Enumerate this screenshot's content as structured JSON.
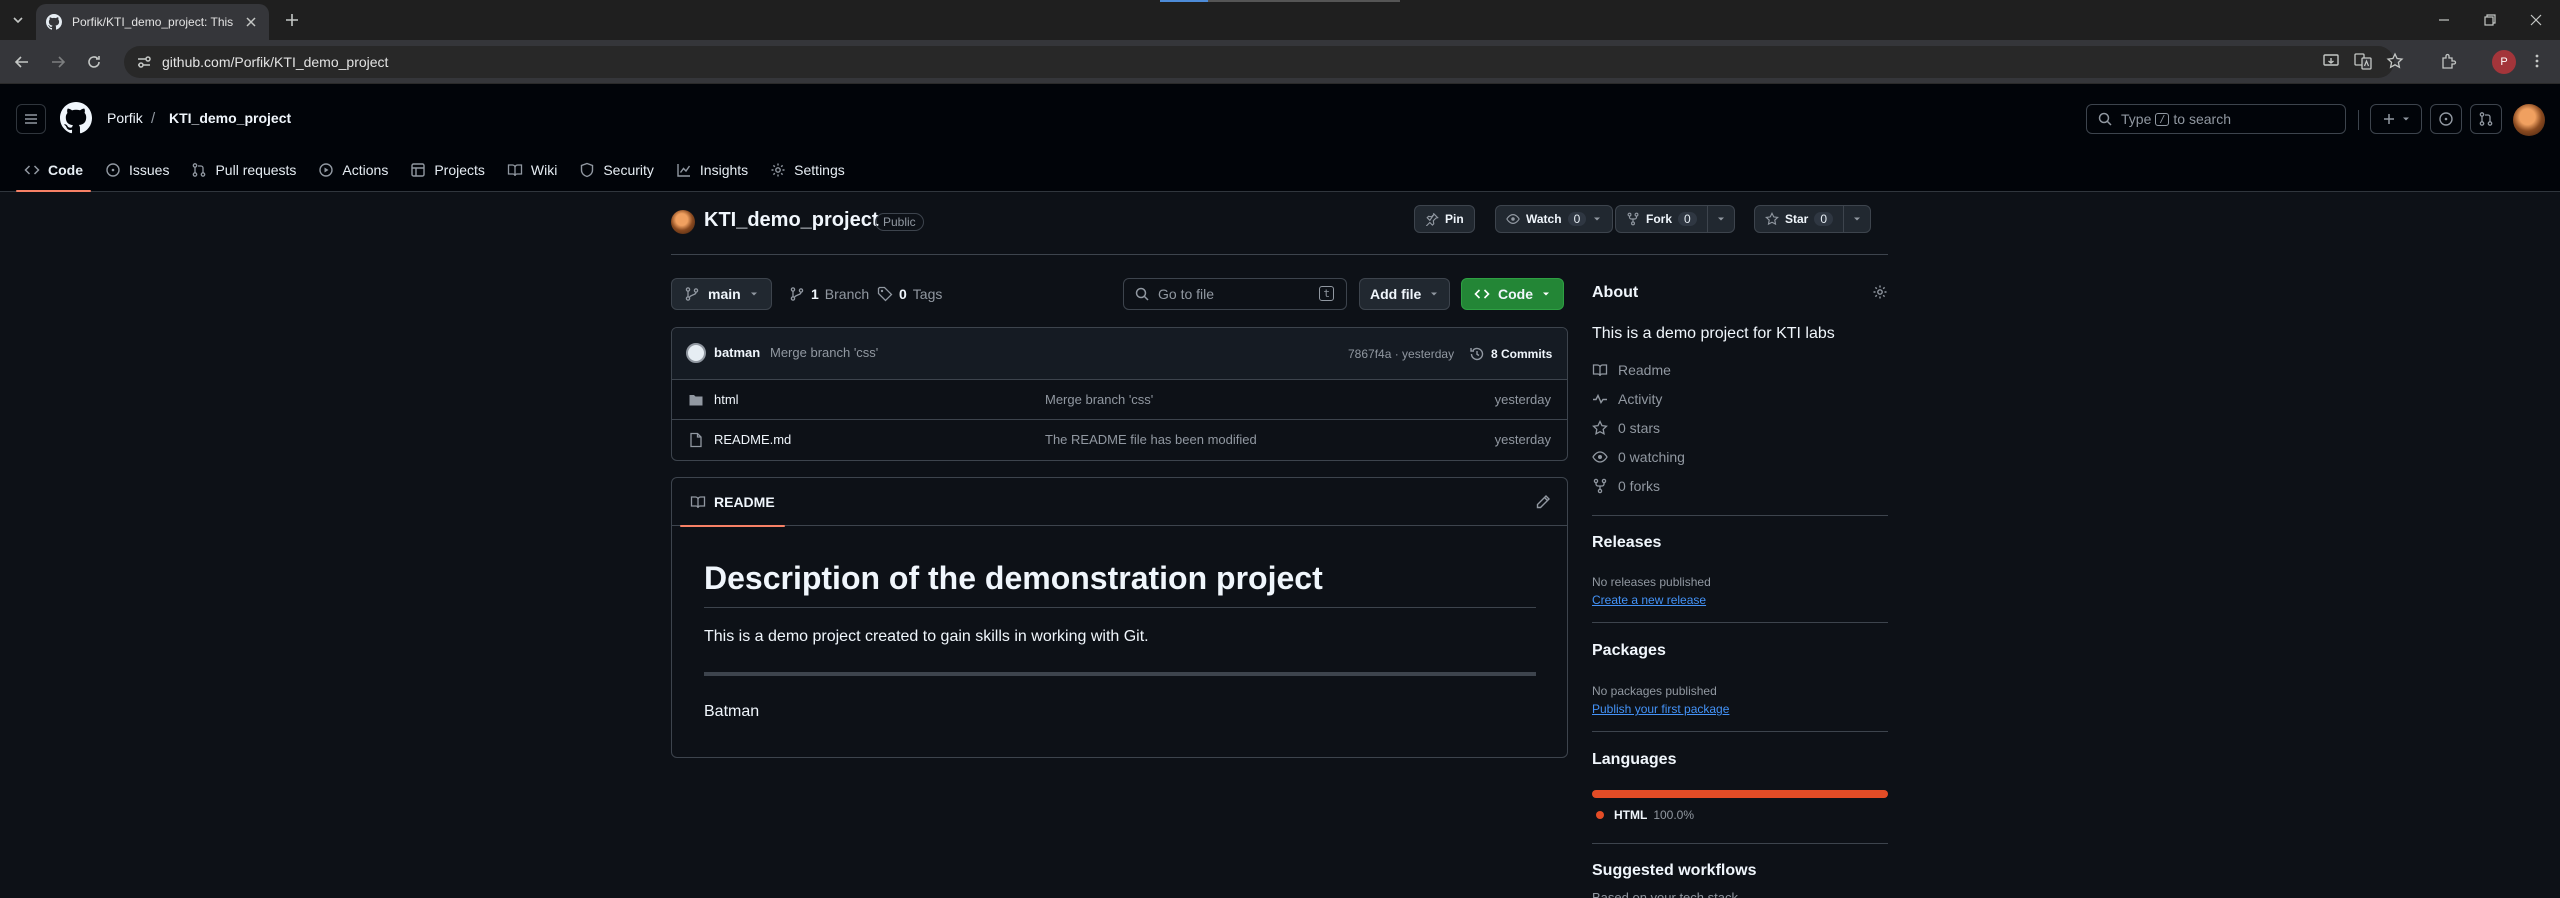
{
  "browser": {
    "tab_title": "Porfik/KTI_demo_project: This is",
    "url": "github.com/Porfik/KTI_demo_project",
    "profile_initial": "P"
  },
  "header": {
    "owner": "Porfik",
    "separator": "/",
    "repo": "KTI_demo_project",
    "search_prefix": "Type",
    "search_key": "/",
    "search_suffix": "to search"
  },
  "repo_nav": [
    {
      "label": "Code",
      "icon": "code-icon",
      "active": true
    },
    {
      "label": "Issues",
      "icon": "issue-icon"
    },
    {
      "label": "Pull requests",
      "icon": "pull-request-icon"
    },
    {
      "label": "Actions",
      "icon": "play-icon"
    },
    {
      "label": "Projects",
      "icon": "table-icon"
    },
    {
      "label": "Wiki",
      "icon": "book-icon"
    },
    {
      "label": "Security",
      "icon": "shield-icon"
    },
    {
      "label": "Insights",
      "icon": "graph-icon"
    },
    {
      "label": "Settings",
      "icon": "gear-icon"
    }
  ],
  "repo": {
    "name": "KTI_demo_project",
    "visibility": "Public",
    "pin_label": "Pin",
    "watch_label": "Watch",
    "watch_count": "0",
    "fork_label": "Fork",
    "fork_count": "0",
    "star_label": "Star",
    "star_count": "0"
  },
  "toolbar": {
    "branch": "main",
    "branches_count": "1",
    "branches_label": "Branch",
    "tags_count": "0",
    "tags_label": "Tags",
    "goto_placeholder": "Go to file",
    "goto_key": "t",
    "add_file_label": "Add file",
    "code_label": "Code"
  },
  "latest_commit": {
    "author": "batman",
    "message": "Merge branch 'css'",
    "sha_time": "7867f4a · yesterday",
    "commits_label": "8 Commits"
  },
  "files": [
    {
      "type": "folder",
      "name": "html",
      "message": "Merge branch 'css'",
      "date": "yesterday"
    },
    {
      "type": "file",
      "name": "README.md",
      "message": "The README file has been modified",
      "date": "yesterday"
    }
  ],
  "readme": {
    "tab_label": "README",
    "h1": "Description of the demonstration project",
    "paragraph": "This is a demo project created to gain skills in working with Git.",
    "signature": "Batman"
  },
  "about": {
    "title": "About",
    "description": "This is a demo project for KTI labs",
    "links": [
      {
        "icon": "book-icon",
        "label": "Readme"
      },
      {
        "icon": "pulse-icon",
        "label": "Activity"
      },
      {
        "icon": "star-icon",
        "label": "0 stars"
      },
      {
        "icon": "eye-icon",
        "label": "0 watching"
      },
      {
        "icon": "fork-icon",
        "label": "0 forks"
      }
    ]
  },
  "releases": {
    "title": "Releases",
    "empty": "No releases published",
    "link": "Create a new release"
  },
  "packages": {
    "title": "Packages",
    "empty": "No packages published",
    "link": "Publish your first package"
  },
  "languages": {
    "title": "Languages",
    "items": [
      {
        "name": "HTML",
        "percent": "100.0%",
        "color": "#e34c26"
      }
    ]
  },
  "workflows": {
    "title": "Suggested workflows",
    "subtitle": "Based on your tech stack"
  },
  "colors": {
    "accent_underline": "#f78166",
    "primary_green": "#238636",
    "link_blue": "#4493f8"
  }
}
